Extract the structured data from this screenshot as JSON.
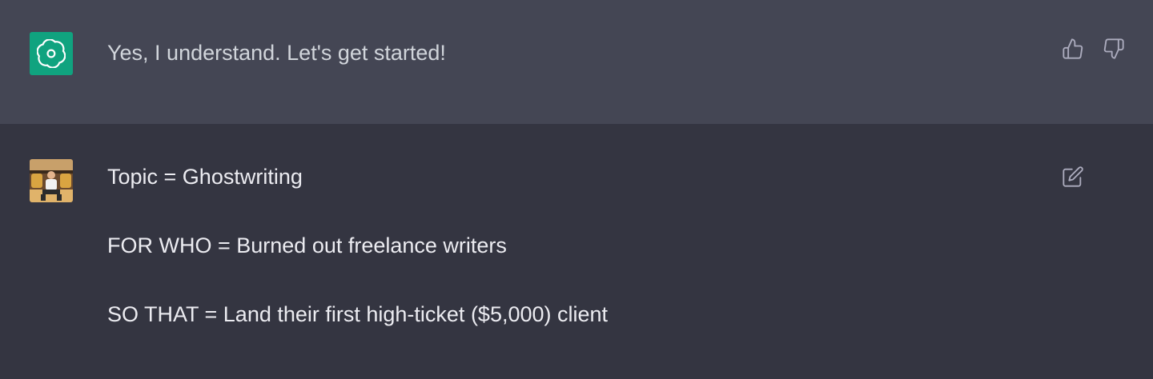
{
  "assistant_message": {
    "text": "Yes, I understand. Let's get started!",
    "avatar_icon": "openai-logo-icon",
    "avatar_color": "#10a37f",
    "actions": [
      "thumbs-up-icon",
      "thumbs-down-icon"
    ]
  },
  "user_message": {
    "lines": [
      "Topic = Ghostwriting",
      "FOR WHO = Burned out freelance writers",
      "SO THAT = Land their first high-ticket ($5,000) client"
    ],
    "avatar_icon": "user-photo-avatar",
    "actions": [
      "edit-icon"
    ]
  },
  "colors": {
    "assistant_bg": "#444654",
    "user_bg": "#343541",
    "text": "#ececf1"
  }
}
